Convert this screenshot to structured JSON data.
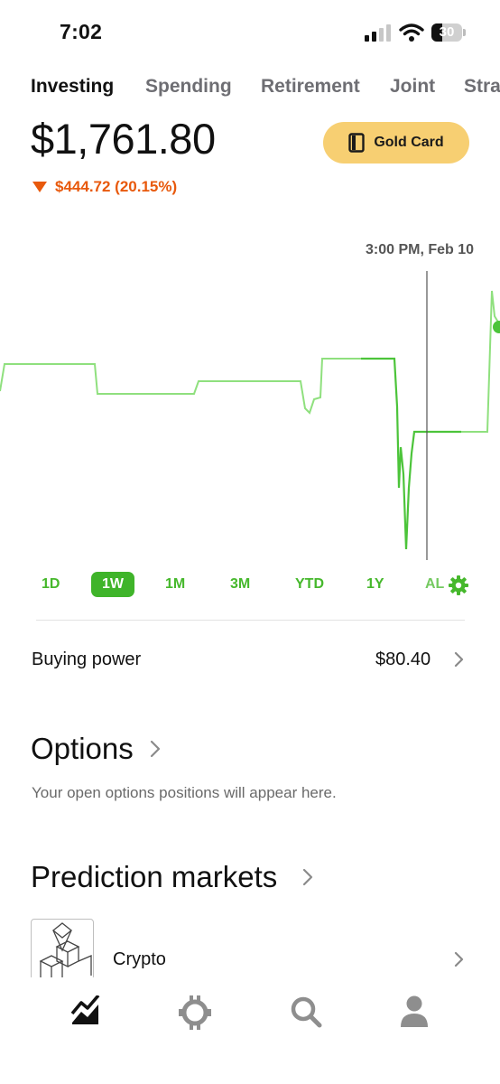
{
  "status_bar": {
    "time": "7:02",
    "battery": "30"
  },
  "tabs": [
    {
      "label": "Investing",
      "active": true
    },
    {
      "label": "Spending",
      "active": false
    },
    {
      "label": "Retirement",
      "active": false
    },
    {
      "label": "Joint",
      "active": false
    },
    {
      "label": "Stra",
      "active": false
    }
  ],
  "portfolio": {
    "balance": "$1,761.80",
    "change": "$444.72 (20.15%)",
    "change_direction": "down",
    "change_color": "#e8590c"
  },
  "gold_card": {
    "label": "Gold Card",
    "color": "#f7cf72"
  },
  "chart": {
    "hover_label": "3:00 PM, Feb 10",
    "line_color": "#5fd14a",
    "icon": "gear-icon"
  },
  "ranges": [
    "1D",
    "1W",
    "1M",
    "3M",
    "YTD",
    "1Y",
    "AL"
  ],
  "selected_range": "1W",
  "buying_power": {
    "label": "Buying power",
    "value": "$80.40"
  },
  "options": {
    "title": "Options",
    "description": "Your open options positions will appear here."
  },
  "prediction_markets": {
    "title": "Prediction markets",
    "items": [
      {
        "label": "Crypto"
      }
    ]
  },
  "bottom_nav": [
    "chart-icon",
    "crypto-icon",
    "search-icon",
    "account-icon"
  ]
}
